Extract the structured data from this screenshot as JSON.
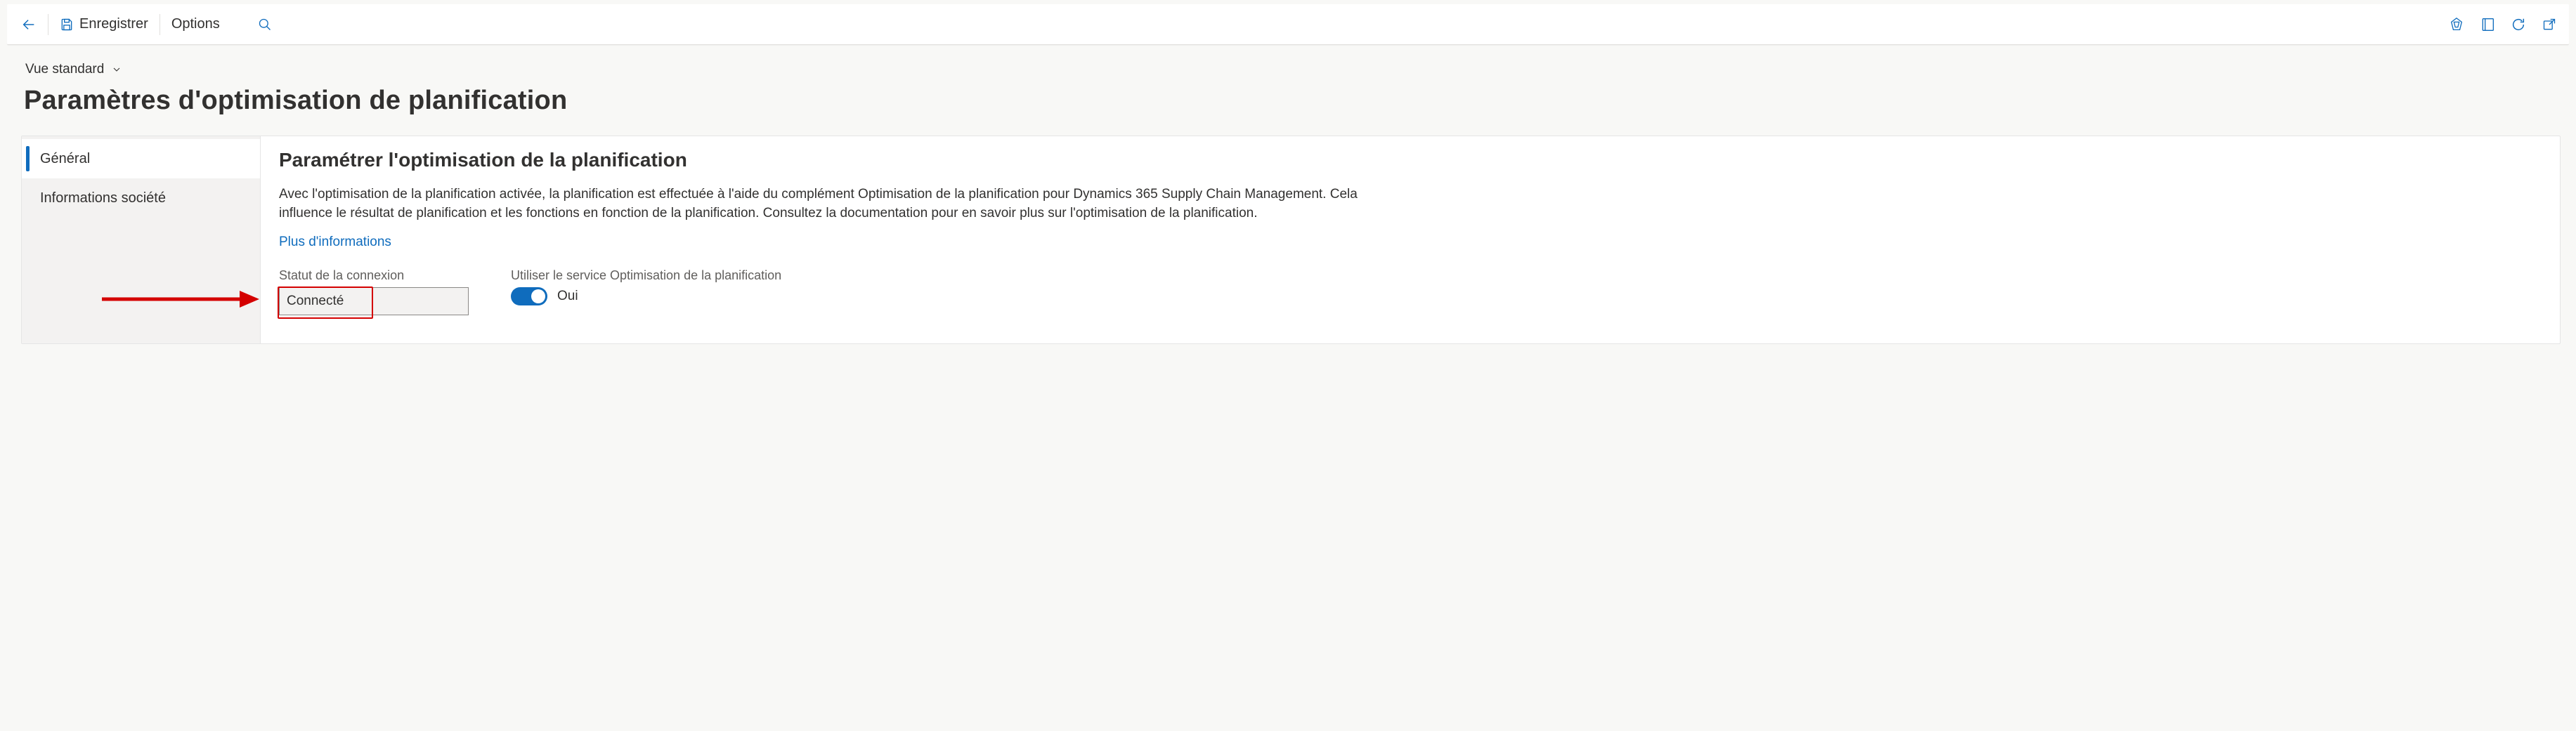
{
  "toolbar": {
    "save_label": "Enregistrer",
    "options_label": "Options"
  },
  "header": {
    "view_label": "Vue standard",
    "page_title": "Paramètres d'optimisation de planification"
  },
  "sidebar": {
    "items": [
      {
        "label": "Général",
        "active": true
      },
      {
        "label": "Informations société",
        "active": false
      }
    ]
  },
  "content": {
    "section_title": "Paramétrer l'optimisation de la planification",
    "section_desc": "Avec l'optimisation de la planification activée, la planification est effectuée à l'aide du complément Optimisation de la planification pour Dynamics 365 Supply Chain Management. Cela influence le résultat de planification et les fonctions en fonction de la planification. Consultez la documentation pour en savoir plus sur l'optimisation de la planification.",
    "more_info_link": "Plus d'informations",
    "connection_status_label": "Statut de la connexion",
    "connection_status_value": "Connecté",
    "use_service_label": "Utiliser le service Optimisation de la planification",
    "toggle_state_label": "Oui",
    "toggle_on": true
  },
  "colors": {
    "accent": "#0f6cbd",
    "annotation": "#d40000"
  }
}
